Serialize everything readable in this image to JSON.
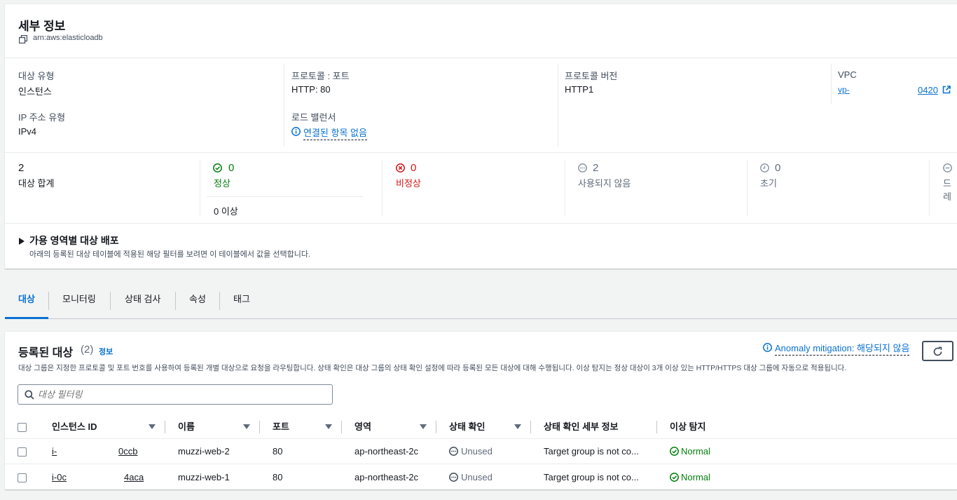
{
  "details": {
    "title": "세부 정보",
    "arn": "arn:aws:elasticloadb",
    "target_type_label": "대상 유형",
    "target_type_value": "인스턴스",
    "protocol_port_label": "프로토콜 : 포트",
    "protocol_port_value": "HTTP: 80",
    "protocol_version_label": "프로토콜 버전",
    "protocol_version_value": "HTTP1",
    "vpc_label": "VPC",
    "vpc_link_prefix": "vp-",
    "vpc_link_suffix": "0420",
    "ip_type_label": "IP 주소 유형",
    "ip_type_value": "IPv4",
    "lb_label": "로드 밸런서",
    "lb_value": "연결된 항목 없음"
  },
  "counts": {
    "total_value": "2",
    "total_label": "대상 합계",
    "healthy_value": "0",
    "healthy_label": "정상",
    "healthy_sub": "0 이상",
    "unhealthy_value": "0",
    "unhealthy_label": "비정상",
    "unused_value": "2",
    "unused_label": "사용되지 않음",
    "initial_value": "0",
    "initial_label": "초기",
    "draining_label": "드레"
  },
  "az": {
    "title": "가용 영역별 대상 배포",
    "desc": "아래의 등록된 대상 테이블에 적용된 해당 필터를 보려면 이 테이블에서 값을 선택합니다."
  },
  "tabs": [
    "대상",
    "모니터링",
    "상태 검사",
    "속성",
    "태그"
  ],
  "targets": {
    "title": "등록된 대상",
    "count": "(2)",
    "info": "정보",
    "anomaly": "Anomaly mitigation: 해당되지 않음",
    "desc": "대상 그룹은 지정한 프로토콜 및 포트 번호를 사용하여 등록된 개별 대상으로 요청을 라우팅합니다. 상태 확인은 대상 그룹의 상태 확인 설정에 따라 등록된 모든 대상에 대해 수행됩니다. 이상 탐지는 정상 대상이 3개 이상 있는 HTTP/HTTPS 대상 그룹에 자동으로 적용됩니다.",
    "filter_placeholder": "대상 필터링",
    "columns": [
      "인스턴스 ID",
      "이름",
      "포트",
      "영역",
      "상태 확인",
      "상태 확인 세부 정보",
      "이상 탐지"
    ],
    "rows": [
      {
        "id_prefix": "i-",
        "id_suffix": "0ccb",
        "name": "muzzi-web-2",
        "port": "80",
        "zone": "ap-northeast-2c",
        "health": "Unused",
        "details": "Target group is not co...",
        "anomaly": "Normal"
      },
      {
        "id_prefix": "i-0c",
        "id_suffix": "4aca",
        "name": "muzzi-web-1",
        "port": "80",
        "zone": "ap-northeast-2c",
        "health": "Unused",
        "details": "Target group is not co...",
        "anomaly": "Normal"
      }
    ]
  },
  "colors": {
    "link": "#0972d3",
    "success": "#037f0c",
    "error": "#d91515",
    "muted": "#5f6b7a"
  }
}
